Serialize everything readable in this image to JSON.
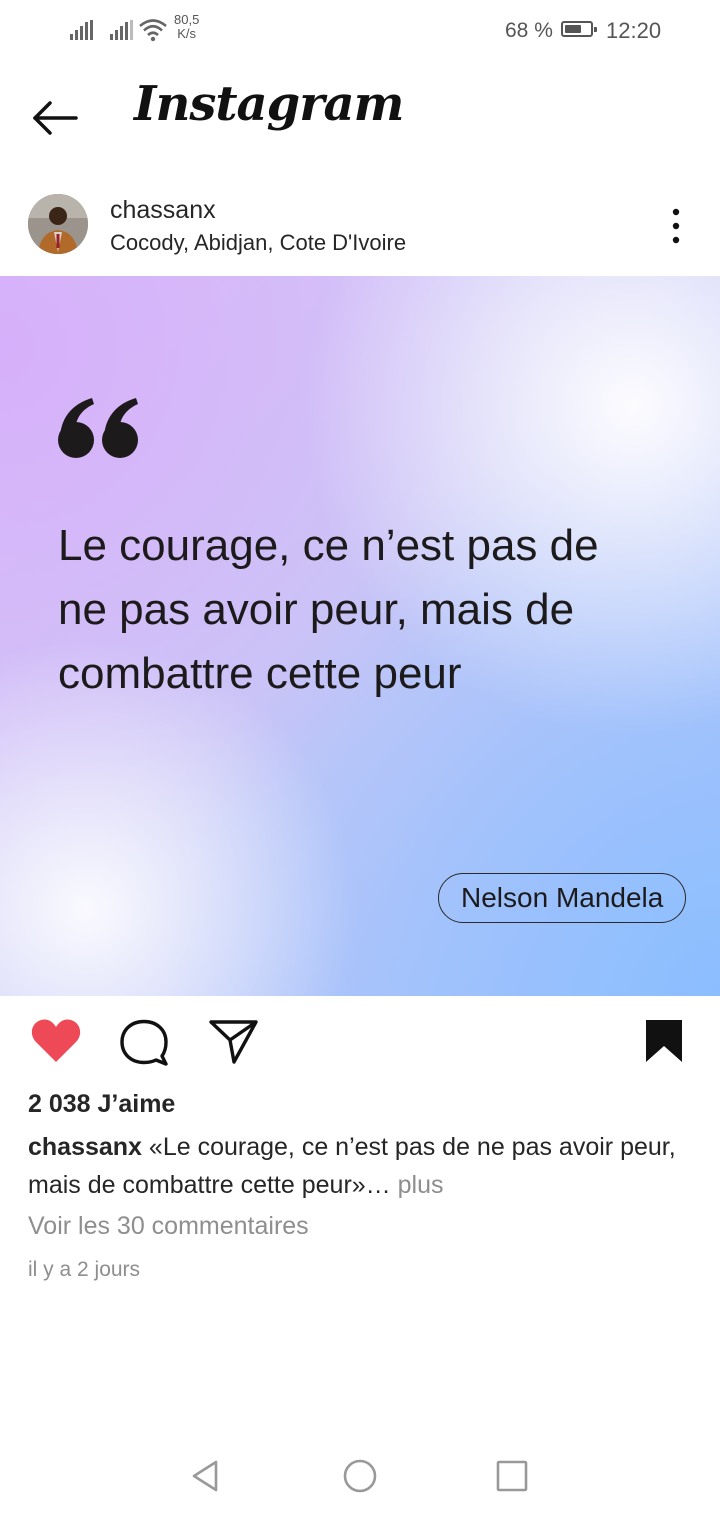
{
  "status_bar": {
    "net_speed_value": "80,5",
    "net_speed_unit": "K/s",
    "battery_percent": "68 %",
    "battery_level": 0.68,
    "time": "12:20"
  },
  "header": {
    "app_title": "Instagram"
  },
  "post": {
    "username": "chassanx",
    "location": "Cocody, Abidjan, Cote D'Ivoire",
    "quote_text": "Le courage, ce n’est pas de ne pas avoir peur, mais de combattre cette peur",
    "author": "Nelson Mandela",
    "colors": {
      "like_red": "#ed4956",
      "gradient_purple": "#d6b0fa",
      "gradient_blue": "#8cbeff"
    }
  },
  "meta": {
    "likes": "2 038 J’aime",
    "caption_username": "chassanx",
    "caption_text": "«Le courage, ce n’est pas de ne pas avoir peur, mais de combattre cette peur»…",
    "caption_more": "plus",
    "comments_link": "Voir les 30 commentaires",
    "timestamp": "il y a 2 jours"
  },
  "icons": {
    "back": "arrow-left-icon",
    "more": "more-vertical-icon",
    "like": "heart-filled-icon",
    "comment": "comment-icon",
    "share": "send-icon",
    "save": "bookmark-filled-icon",
    "nav_back": "triangle-back-icon",
    "nav_home": "circle-home-icon",
    "nav_recents": "square-recents-icon"
  }
}
